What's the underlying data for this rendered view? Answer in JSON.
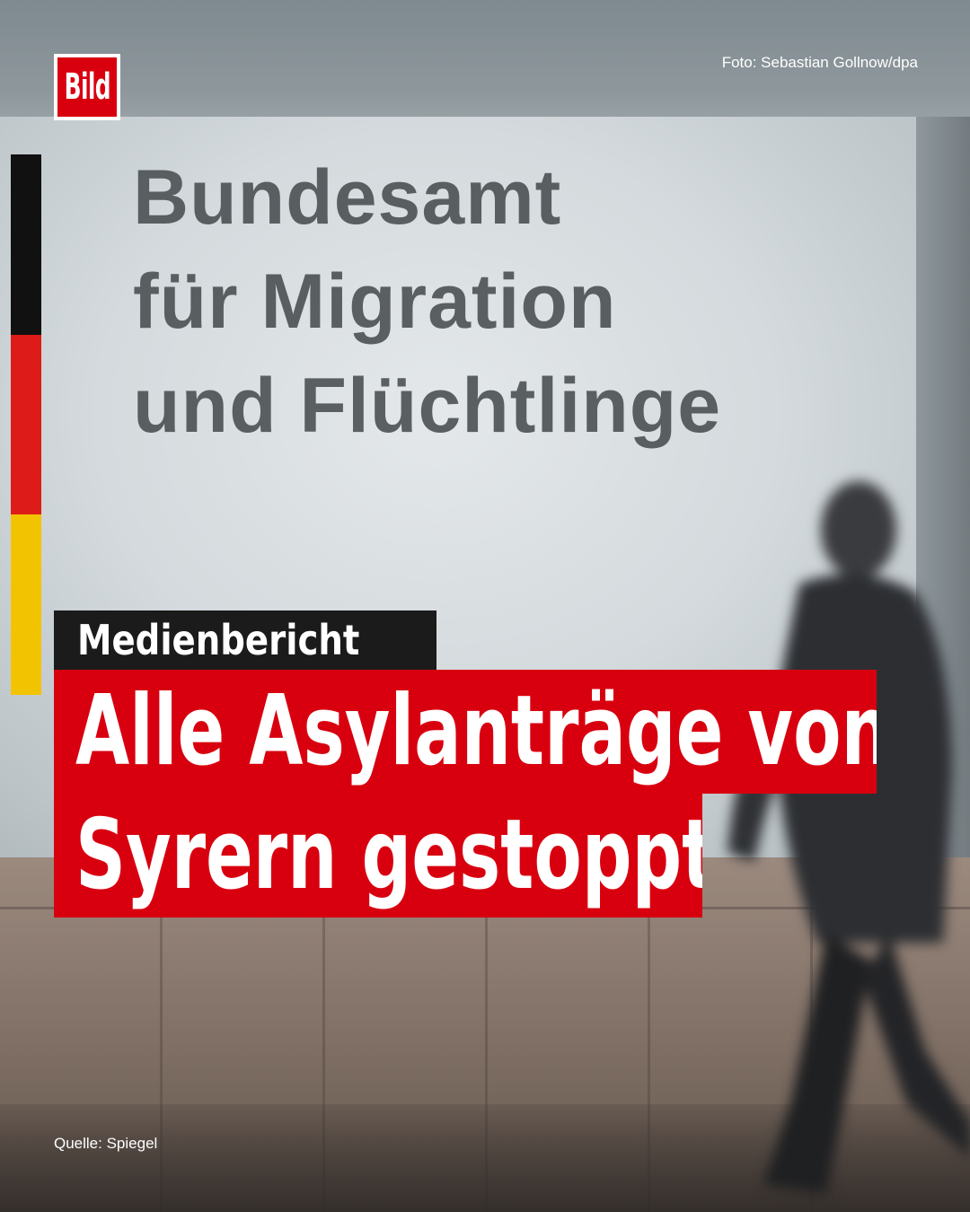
{
  "brand": {
    "logo_text": "Bild",
    "accent_color": "#d8000f"
  },
  "photo_credit": "Foto: Sebastian Gollnow/dpa",
  "sign": {
    "lines": [
      "Bundesamt",
      "für Migration",
      "und Flüchtlinge"
    ]
  },
  "flag_colors": [
    "#111111",
    "#dd1c1a",
    "#f2c300"
  ],
  "kicker": "Medienbericht",
  "headline": {
    "line1": "Alle Asylanträge von",
    "line2": "Syrern gestoppt"
  },
  "source": "Quelle: Spiegel"
}
